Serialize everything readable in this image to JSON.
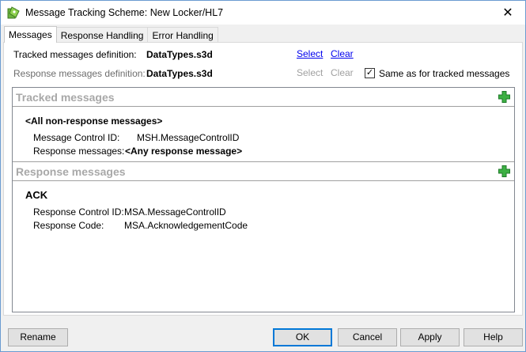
{
  "window": {
    "title": "Message Tracking Scheme: New Locker/HL7",
    "icon": "app-icon",
    "close_glyph": "✕"
  },
  "tabs": [
    {
      "label": "Messages",
      "active": true
    },
    {
      "label": "Response Handling",
      "active": false
    },
    {
      "label": "Error Handling",
      "active": false
    }
  ],
  "definitions": {
    "tracked": {
      "label": "Tracked messages definition:",
      "value": "DataTypes.s3d",
      "select": "Select",
      "clear": "Clear"
    },
    "response": {
      "label": "Response messages definition:",
      "value": "DataTypes.s3d",
      "select": "Select",
      "clear": "Clear",
      "same_as_label": "Same as for tracked messages",
      "same_as_checked": true
    }
  },
  "tracked_section": {
    "title": "Tracked messages",
    "message_name": "<All non-response messages>",
    "fields": [
      {
        "label": "Message Control ID:",
        "value": "MSH.MessageControlID",
        "bold": false
      },
      {
        "label": "Response messages:",
        "value": "<Any response message>",
        "bold": true
      }
    ]
  },
  "response_section": {
    "title": "Response messages",
    "message_name": "ACK",
    "fields": [
      {
        "label": "Response Control ID:",
        "value": "MSA.MessageControlID"
      },
      {
        "label": "Response Code:",
        "value": "MSA.AcknowledgementCode"
      }
    ]
  },
  "buttons": {
    "rename": "Rename",
    "ok": "OK",
    "cancel": "Cancel",
    "apply": "Apply",
    "help": "Help"
  },
  "colors": {
    "accent": "#0078d7",
    "link": "#0000ee",
    "plus_green": "#3cb043",
    "section_title": "#a8a8a8"
  }
}
